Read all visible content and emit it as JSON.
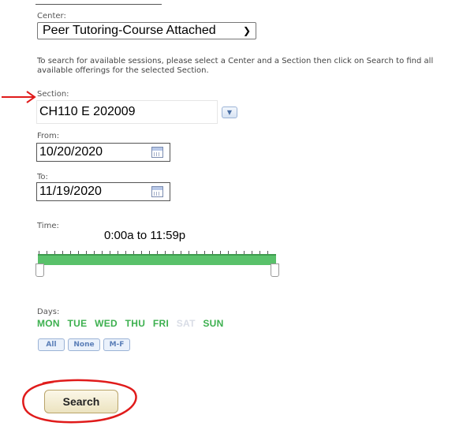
{
  "center": {
    "label": "Center:",
    "selected": "Peer Tutoring-Course Attached"
  },
  "instructions": "To search for available sessions, please select a Center and a Section then click on Search to find all available offerings for the selected Section.",
  "section": {
    "label": "Section:",
    "value": "CH110 E 202009"
  },
  "from": {
    "label": "From:",
    "value": "10/20/2020"
  },
  "to": {
    "label": "To:",
    "value": "11/19/2020"
  },
  "time": {
    "label": "Time:",
    "range_text": "0:00a to 11:59p"
  },
  "days": {
    "label": "Days:",
    "items": [
      {
        "label": "MON",
        "selected": true
      },
      {
        "label": "TUE",
        "selected": true
      },
      {
        "label": "WED",
        "selected": true
      },
      {
        "label": "THU",
        "selected": true
      },
      {
        "label": "FRI",
        "selected": true
      },
      {
        "label": "SAT",
        "selected": false
      },
      {
        "label": "SUN",
        "selected": true
      }
    ],
    "presets": [
      "All",
      "None",
      "M-F"
    ]
  },
  "search_button": "Search",
  "colors": {
    "day_selected": "#3db04f",
    "day_unselected": "#d9dde6",
    "slider_fill": "#59c16a",
    "annotation": "#e01b1b"
  }
}
